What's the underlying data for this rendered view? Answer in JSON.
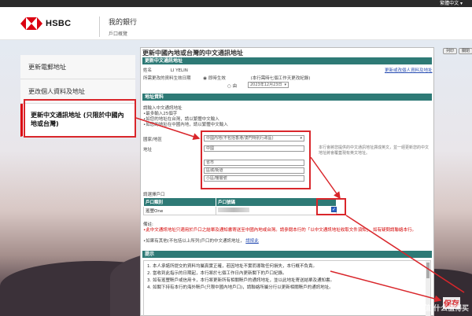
{
  "topbar": {
    "language": "繁體中文 ▾"
  },
  "header": {
    "brand": "HSBC",
    "title": "我的銀行",
    "subtitle": "戶口概覽"
  },
  "sidebar": {
    "items": [
      {
        "label": "更新電郵地址"
      },
      {
        "label": "更改個人資料及地址"
      },
      {
        "label": "更新中文通訊地址 (只限於中國內地或台灣)"
      }
    ]
  },
  "form": {
    "title": "更新中國內地或台灣的中文通訊地址",
    "print_label": "列印",
    "close_label": "關閉",
    "section1_head": "更新中文通訊地址",
    "name_label": "姓名",
    "name_value": "LI YELIN",
    "change_link": "更新或改個人資料及地址",
    "effective_label": "所需更改的資料生效日期",
    "option_immediate": "即時生效",
    "option_from": "由",
    "date_value": "2023年12月23日",
    "date_note": "(本行需時七個工作天更改紀錄)",
    "section2_head": "地址資料",
    "instructions": [
      "請輸入中文通訊地址",
      "•最多輸入25個字",
      "•如您的地址在台灣，請以繁體中文輸入",
      "•如您的地址在中國內地，請以繁體中文輸入"
    ],
    "region_label": "國家/地區",
    "region_value": "中國內地(不包括香港/澳門特別行政區)",
    "address_label": "地址",
    "address_fields": [
      "中國",
      "省市",
      "區城/街道",
      "小區/樓層號"
    ],
    "address_hint": "本行會將您提供的中文通訊地址譯成英文，並一經更新您的中文地址將會覆蓋現有英文地址。",
    "account_head": "請選擇戶口",
    "account_col1": "戶口類別",
    "account_col2": "戶口號碼",
    "account_type": "滙豐One",
    "notes_label": "備註:",
    "note1": "•此中文通訊地址只適用於戶口之結單及通知書寄送至中國內地或台灣。請參閱本行的「以中文通訊地址收取文件須知」，如有疑問請聯絡本行。",
    "note1_link": "以中文通訊地址收取文件須知",
    "note2": "•如果有其他(不包括以上所列)戶口的中文通訊地址，",
    "note2_link": "請按此",
    "tips_head": "提示",
    "tips": [
      "1. 本人承諾所提交的資料均屬真實正確，若因地址不實而導致任何損失，本行概不負責。",
      "2. 當收到此指示的日期起，本行將於七個工作日內更新閣下的戶口紀錄。",
      "3. 如有滙豐賬戶或信用卡，本行將更新所有相關賬戶的通訊地址，並以此地址寄送結單及通知書。",
      "4. 如閣下持有本行的海外賬戶(只限中國內地戶口)，請聯絡所屬分行以更新相關賬戶的通訊地址。"
    ],
    "save_annotation": "保存"
  },
  "watermark": "值 什么值得买",
  "colors": {
    "accent": "#db0011",
    "section": "#2e7a76",
    "annotation": "#d9262b"
  }
}
